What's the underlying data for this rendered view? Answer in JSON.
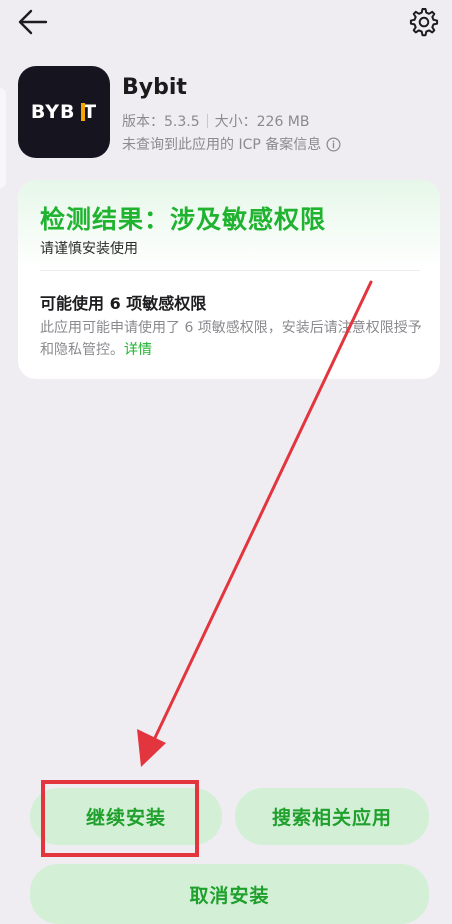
{
  "topbar": {
    "back_icon": "arrow-left-icon",
    "settings_icon": "gear-icon"
  },
  "app": {
    "logo_text": "BYB T",
    "name": "Bybit",
    "version": "版本：5.3.5",
    "size": "大小：226 MB",
    "icp_note": "未查询到此应用的 ICP 备案信息",
    "info_icon": "info-circle-icon",
    "logo_accent": "#f7a600"
  },
  "result": {
    "title": "检测结果：涉及敏感权限",
    "subtitle": "请谨慎安装使用",
    "perm_title": "可能使用 6 项敏感权限",
    "perm_desc": "此应用可能申请使用了 6 项敏感权限，安装后请注意权限授予和隐私管控。",
    "detail_link": "详情",
    "accent": "#1fb32f"
  },
  "actions": {
    "continue_label": "继续安装",
    "search_label": "搜索相关应用",
    "cancel_label": "取消安装",
    "button_bg": "#d3f0d6"
  },
  "annotation": {
    "color": "#e3353d"
  }
}
